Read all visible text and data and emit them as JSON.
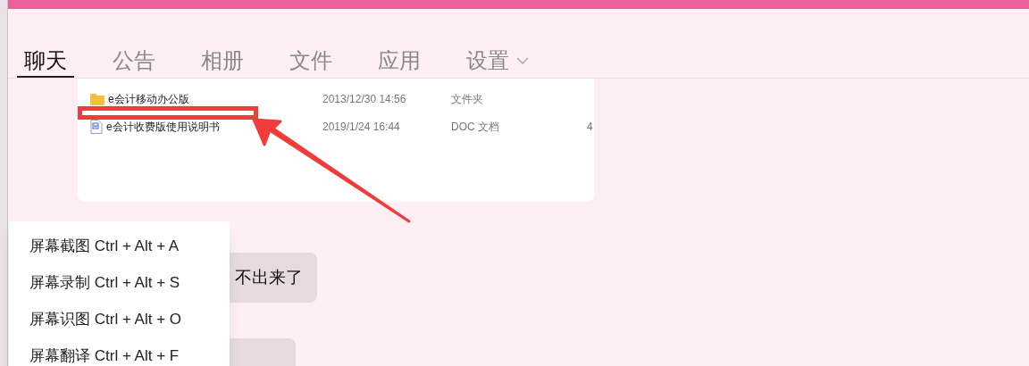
{
  "tabs": [
    {
      "label": "聊天",
      "selected": true
    },
    {
      "label": "公告",
      "selected": false
    },
    {
      "label": "相册",
      "selected": false
    },
    {
      "label": "文件",
      "selected": false
    },
    {
      "label": "应用",
      "selected": false
    },
    {
      "label": "设置",
      "selected": false,
      "dropdown": true
    }
  ],
  "files": [
    {
      "kind": "folder",
      "name": "e会计移动办公版",
      "date": "2013/12/30 14:56",
      "type": "文件夹"
    },
    {
      "kind": "doc",
      "name": "e会计收费版使用说明书",
      "date": "2019/1/24 16:44",
      "type": "DOC 文档",
      "size": "4"
    }
  ],
  "messages": [
    {
      "kind": "text",
      "text": "不出来了"
    },
    {
      "kind": "text"
    }
  ],
  "menu": [
    {
      "label": "屏幕截图 Ctrl + Alt + A"
    },
    {
      "label": "屏幕录制 Ctrl + Alt + S"
    },
    {
      "label": "屏幕识图 Ctrl + Alt + O"
    },
    {
      "label": "屏幕翻译 Ctrl + Alt + F"
    }
  ]
}
